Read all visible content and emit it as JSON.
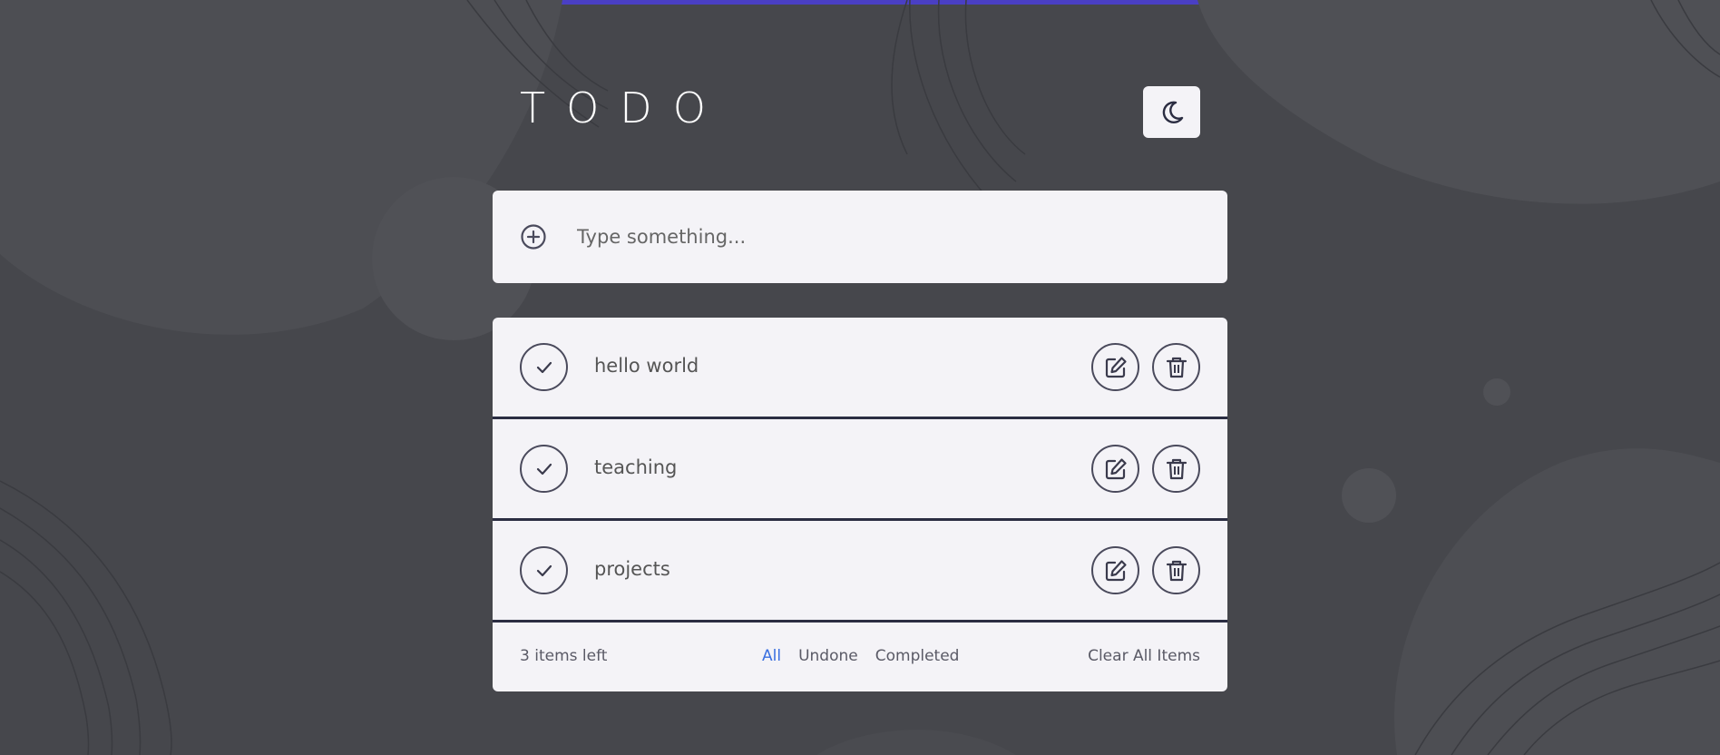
{
  "header": {
    "title": "TODO",
    "theme_toggle_icon": "moon-icon"
  },
  "add_bar": {
    "icon": "plus-circle-icon",
    "placeholder": "Type something..."
  },
  "todos": [
    {
      "text": "hello world",
      "done": false
    },
    {
      "text": "teaching",
      "done": false
    },
    {
      "text": "projects",
      "done": false
    }
  ],
  "footer": {
    "items_left": "3 items left",
    "filters": [
      {
        "label": "All",
        "active": true
      },
      {
        "label": "Undone",
        "active": false
      },
      {
        "label": "Completed",
        "active": false
      }
    ],
    "clear_label": "Clear All Items"
  },
  "colors": {
    "background": "#46474c",
    "card": "#f4f3f7",
    "accent": "#3a6fe0",
    "divider": "#2b2d42",
    "top_strip": "#4a3fc4"
  }
}
